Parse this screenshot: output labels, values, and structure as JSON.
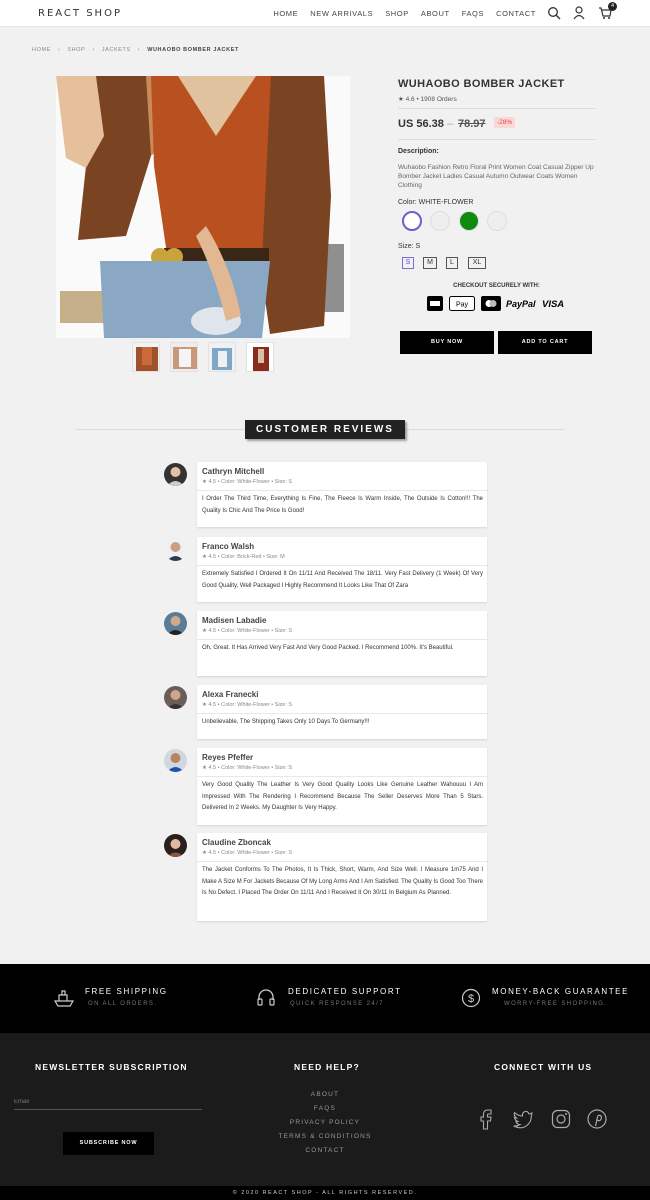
{
  "header": {
    "logo": "REACT SHOP",
    "nav": [
      "HOME",
      "NEW ARRIVALS",
      "SHOP",
      "ABOUT",
      "FAQS",
      "CONTACT"
    ],
    "cart_count": "4"
  },
  "breadcrumb": [
    "HOME",
    "SHOP",
    "JACKETS",
    "WUHAOBO BOMBER JACKET"
  ],
  "product": {
    "title": "WUHAOBO BOMBER JACKET",
    "rating": "4.6 • 1908 Orders",
    "price": "US 56.38",
    "price_sep": "–",
    "old_price": "78.97",
    "discount": "-28%",
    "description_label": "Description:",
    "description": "Wuhaobo Fashion Retro Floral Print Women Coat Casual Zipper Up Bomber Jacket Ladies Casual Autumn Outwear Coats Women Clothing",
    "color_label": "Color: WHITE-FLOWER",
    "colors": [
      "#ffffff",
      "#eeeeee",
      "#0f8a0f",
      "#eeeeee"
    ],
    "size_label": "Size: S",
    "sizes": [
      "S",
      "M",
      "L",
      "XL"
    ],
    "checkout_label": "CHECKOUT SECURELY WITH:",
    "payment": [
      "AMEX",
      "Pay",
      "MC",
      "PayPal",
      "VISA"
    ],
    "buy_now": "BUY NOW",
    "add_to_cart": "ADD TO CART"
  },
  "reviews": {
    "heading": "CUSTOMER REVIEWS",
    "items": [
      {
        "name": "Cathryn Mitchell",
        "meta": "4.5 • Color: White-Flower • Size: S",
        "text": "I Order The Third Time, Everything Is Fine, The Fleece Is Warm Inside, The Outside Is Cotton!!! The Quality Is Chic And The Price Is Good!"
      },
      {
        "name": "Franco Walsh",
        "meta": "4.5 • Color: Brick-Red • Size: M",
        "text": "Extremely Satisfied I Ordered It On 11/11 And Received The 18/11. Very Fast Delivery (1 Week) Of Very Good Quality, Well Packaged I Highly Recommend It Looks Like That Of Zara"
      },
      {
        "name": "Madisen Labadie",
        "meta": "4.5 • Color: White-Flower • Size: S",
        "text": "Oh, Great. It Has Arrived Very Fast And Very Good Packed. I Recommend 100%. It's Beautiful."
      },
      {
        "name": "Alexa Franecki",
        "meta": "4.5 • Color: White-Flower • Size: S",
        "text": "Unbelievable, The Shipping Takes Only 10 Days To Germany!!!"
      },
      {
        "name": "Reyes Pfeffer",
        "meta": "4.5 • Color: White-Flower • Size: S",
        "text": "Very Good Quality The Leather Is Very Good Quality Looks Like Genuine Leather Wahouuu I Am Impressed With The Rendering I Recommend Because The Seller Deserves More Than 5 Stars. Delivered In 2 Weeks. My Daughter Is Very Happy."
      },
      {
        "name": "Claudine Zboncak",
        "meta": "4.5 • Color: White-Flower • Size: S",
        "text": "The Jacket Conforms To The Photos, It Is Thick, Short, Warm, And Size Well. I Measure 1m75 And I Make A Size M For Jackets Because Of My Long Arms And I Am Satisfied. The Quality Is Good Too There Is No Defect. I Placed The Order On 11/11 And I Received It On 30/11 In Belgium As Planned."
      }
    ]
  },
  "features": [
    {
      "title": "FREE SHIPPING",
      "sub": "ON ALL ORDERS."
    },
    {
      "title": "DEDICATED SUPPORT",
      "sub": "QUICK RESPONSE 24/7"
    },
    {
      "title": "MONEY-BACK GUARANTEE",
      "sub": "WORRY-FREE SHOPPING."
    }
  ],
  "footer": {
    "newsletter_title": "NEWSLETTER SUBSCRIPTION",
    "email_placeholder": "Email",
    "subscribe": "SUBSCRIBE NOW",
    "help_title": "NEED HELP?",
    "help_links": [
      "ABOUT",
      "FAQS",
      "PRIVACY POLICY",
      "TERMS & CONDITIONS",
      "CONTACT"
    ],
    "connect_title": "CONNECT WITH US",
    "copyright": "© 2020 REACT SHOP - ALL RIGHTS RESERVED."
  }
}
